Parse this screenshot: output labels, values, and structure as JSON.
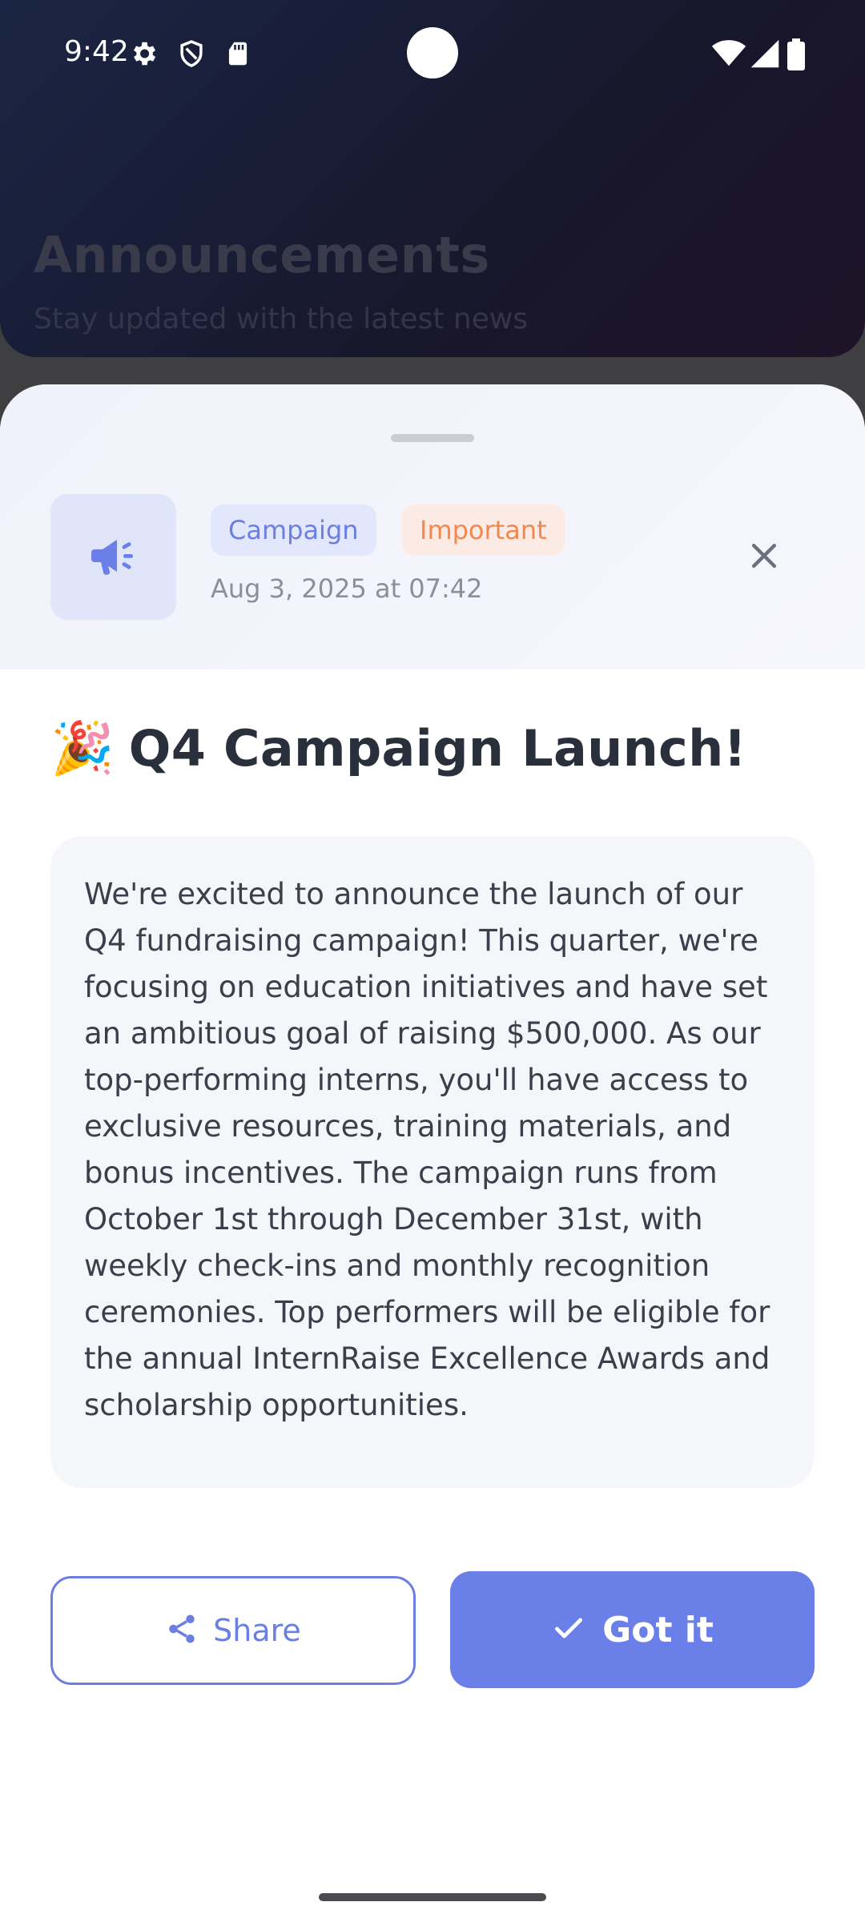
{
  "status_bar": {
    "time": "9:42",
    "left_icons": [
      "gear-icon",
      "shield-icon",
      "sd-card-icon"
    ],
    "right_icons": [
      "wifi-icon",
      "signal-icon",
      "battery-icon"
    ]
  },
  "background_page": {
    "title": "Announcements",
    "subtitle": "Stay updated with the latest news"
  },
  "sheet": {
    "icon": "megaphone-icon",
    "tags": [
      {
        "label": "Campaign",
        "color": "#6b7fe3",
        "bg": "#e3e7fb"
      },
      {
        "label": "Important",
        "color": "#f0894f",
        "bg": "#fbebe4"
      }
    ],
    "date": "Aug 3, 2025 at 07:42",
    "title_emoji": "🎉",
    "title": "Q4 Campaign Launch!",
    "body": "We're excited to announce the launch of our Q4 fundraising campaign! This quarter, we're focusing on education initiatives and have set an ambitious goal of raising $500,000. As our top-performing interns, you'll have access to exclusive resources, training materials, and bonus incentives. The campaign runs from October 1st through December 31st, with weekly check-ins and monthly recognition ceremonies. Top performers will be eligible for the annual InternRaise Excellence Awards and scholarship opportunities.",
    "share_label": "Share",
    "got_it_label": "Got it"
  },
  "colors": {
    "accent": "#6a7fe8",
    "important": "#f0894f",
    "title_text": "#2a2f3c"
  }
}
